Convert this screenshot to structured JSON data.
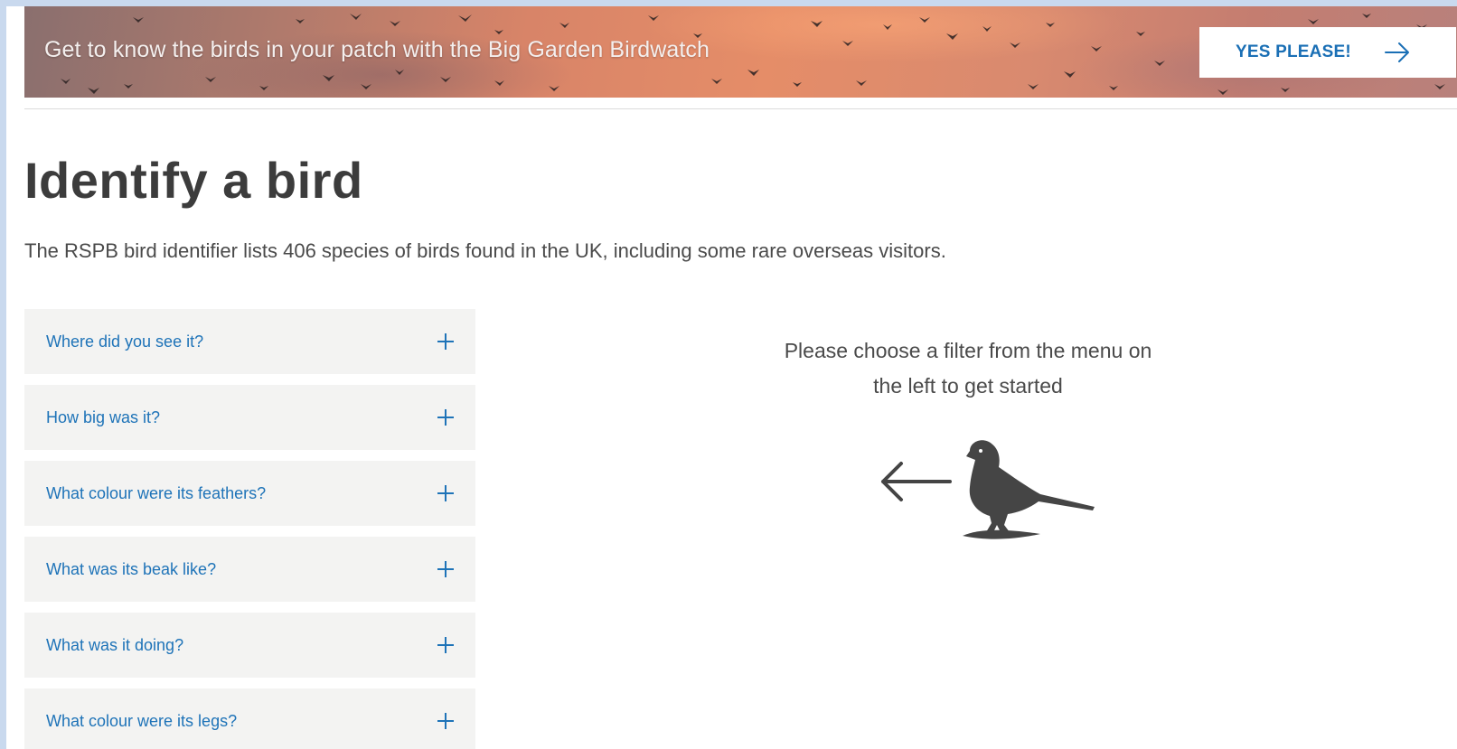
{
  "banner": {
    "text": "Get to know the birds in your patch with the Big Garden Birdwatch",
    "cta_label": "YES PLEASE!"
  },
  "page": {
    "title": "Identify a bird",
    "intro": "The RSPB bird identifier lists 406 species of birds found in the UK, including some rare overseas visitors."
  },
  "filters": [
    {
      "label": "Where did you see it?"
    },
    {
      "label": "How big was it?"
    },
    {
      "label": "What colour were its feathers?"
    },
    {
      "label": "What was its beak like?"
    },
    {
      "label": "What was it doing?"
    },
    {
      "label": "What colour were its legs?"
    }
  ],
  "prompt": {
    "line1": "Please choose a filter from the menu on",
    "line2": "the left to get started"
  },
  "colors": {
    "accent_blue": "#1e73b8",
    "filter_bg": "#f3f3f2",
    "title_gray": "#3c3c3c"
  },
  "icons": {
    "cta": "arrow-right-icon",
    "filter_toggle": "plus-icon",
    "prompt_arrow": "arrow-left-icon",
    "prompt_bird": "robin-silhouette-icon"
  }
}
